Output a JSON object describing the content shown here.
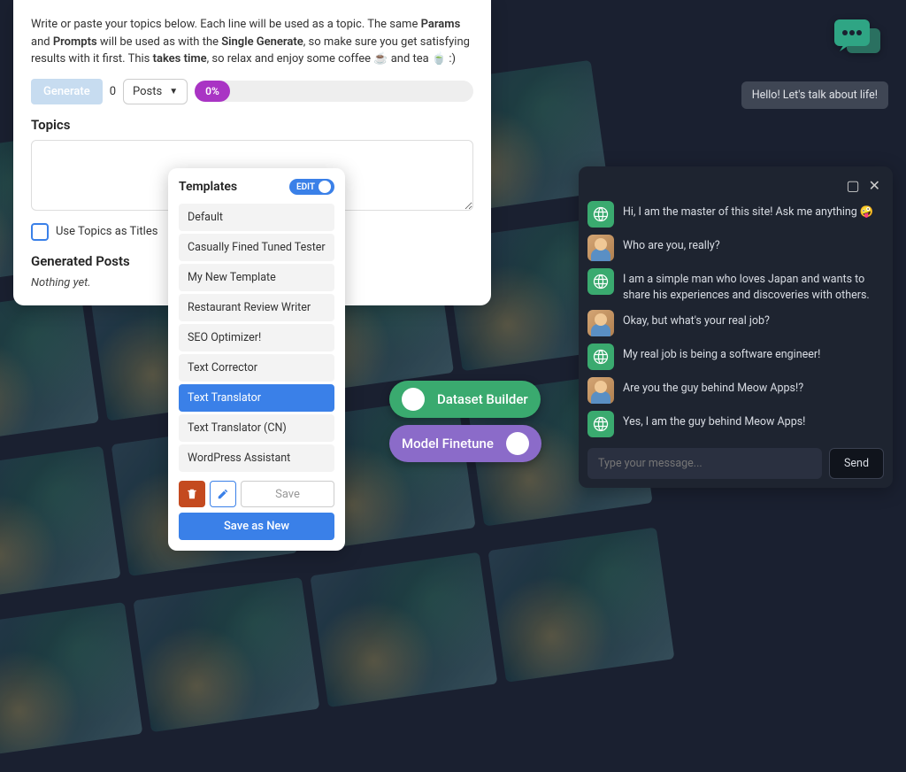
{
  "left": {
    "intro_prefix": "Write or paste your topics below. Each line will be used as a topic. The same ",
    "intro_b1": "Params",
    "intro_mid1": " and ",
    "intro_b2": "Prompts",
    "intro_mid2": " will be used as with the ",
    "intro_b3": "Single Generate",
    "intro_mid3": ", so make sure you get satisfying results with it first. This ",
    "intro_b4": "takes time",
    "intro_suffix": ", so relax and enjoy some coffee ☕ and tea 🍵 :)",
    "generate_label": "Generate",
    "count": "0",
    "posts_label": "Posts",
    "progress_pct": "0%",
    "topics_heading": "Topics",
    "use_topics_label": "Use Topics as Titles",
    "generated_heading": "Generated Posts",
    "nothing_text": "Nothing yet."
  },
  "templates": {
    "title": "Templates",
    "edit_label": "EDIT",
    "items": [
      {
        "label": "Default"
      },
      {
        "label": "Casually Fined Tuned Tester"
      },
      {
        "label": "My New Template"
      },
      {
        "label": "Restaurant Review Writer"
      },
      {
        "label": "SEO Optimizer!"
      },
      {
        "label": "Text Corrector"
      },
      {
        "label": "Text Translator"
      },
      {
        "label": "Text Translator (CN)"
      },
      {
        "label": "WordPress Assistant"
      }
    ],
    "selected_index": 6,
    "save_label": "Save",
    "save_new_label": "Save as New"
  },
  "pills": {
    "dataset": "Dataset Builder",
    "finetune": "Model Finetune"
  },
  "intro_chat": "Hello! Let's talk about life!",
  "chat": {
    "messages": [
      {
        "role": "bot",
        "text": "Hi, I am the master of this site! Ask me anything 🤪"
      },
      {
        "role": "user",
        "text": "Who are you, really?"
      },
      {
        "role": "bot",
        "text": "I am a simple man who loves Japan and wants to share his experiences and discoveries with others."
      },
      {
        "role": "user",
        "text": "Okay, but what's your real job?"
      },
      {
        "role": "bot",
        "text": "My real job is being a software engineer!"
      },
      {
        "role": "user",
        "text": "Are you the guy behind Meow Apps!?"
      },
      {
        "role": "bot",
        "text": "Yes, I am the guy behind Meow Apps!"
      }
    ],
    "input_placeholder": "Type your message...",
    "send_label": "Send"
  }
}
